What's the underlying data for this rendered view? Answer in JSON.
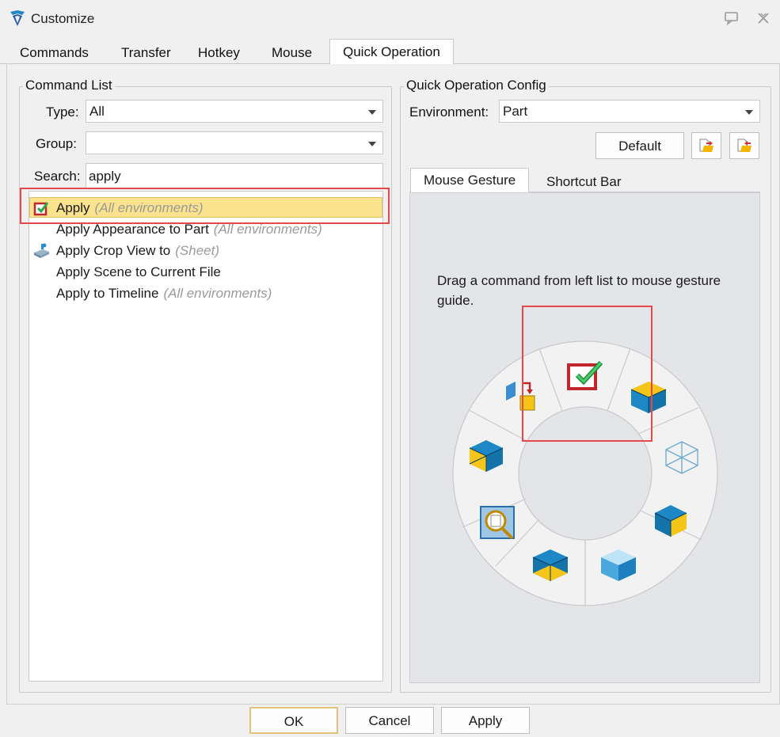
{
  "window": {
    "title": "Customize"
  },
  "tabs": [
    {
      "label": "Commands",
      "active": false
    },
    {
      "label": "Transfer",
      "active": false
    },
    {
      "label": "Hotkey",
      "active": false
    },
    {
      "label": "Mouse",
      "active": false
    },
    {
      "label": "Quick Operation",
      "active": true
    }
  ],
  "command_list": {
    "title": "Command List",
    "type": {
      "label": "Type:",
      "value": "All"
    },
    "group": {
      "label": "Group:",
      "value": ""
    },
    "search": {
      "label": "Search:",
      "value": "apply"
    },
    "items": [
      {
        "name": "Apply",
        "env": "(All environments)",
        "icon": "apply-check-icon",
        "selected": true
      },
      {
        "name": "Apply Appearance to Part",
        "env": "(All environments)",
        "icon": "",
        "selected": false
      },
      {
        "name": "Apply Crop View to",
        "env": "(Sheet)",
        "icon": "crop-view-icon",
        "selected": false
      },
      {
        "name": "Apply Scene to Current File",
        "env": "",
        "icon": "",
        "selected": false
      },
      {
        "name": "Apply to Timeline",
        "env": "(All environments)",
        "icon": "",
        "selected": false
      }
    ]
  },
  "config": {
    "title": "Quick Operation Config",
    "environment": {
      "label": "Environment:",
      "value": "Part"
    },
    "default_label": "Default",
    "subtabs": [
      {
        "label": "Mouse Gesture",
        "active": true
      },
      {
        "label": "Shortcut Bar",
        "active": false
      }
    ],
    "hint": "Drag a command from left list to mouse gesture guide.",
    "gesture_icons": [
      "apply-check-icon",
      "view-cube-iso-icon",
      "view-wireframe-icon",
      "view-right-icon",
      "view-front-icon",
      "view-bottom-icon",
      "zoom-document-icon",
      "view-left-icon",
      "switch-view-icon"
    ]
  },
  "footer": {
    "ok": "OK",
    "cancel": "Cancel",
    "apply": "Apply"
  },
  "colors": {
    "selection": "#fbe38e",
    "highlight": "#e5484d",
    "accent": "#1e88c7",
    "cube_yellow": "#f5c518"
  }
}
